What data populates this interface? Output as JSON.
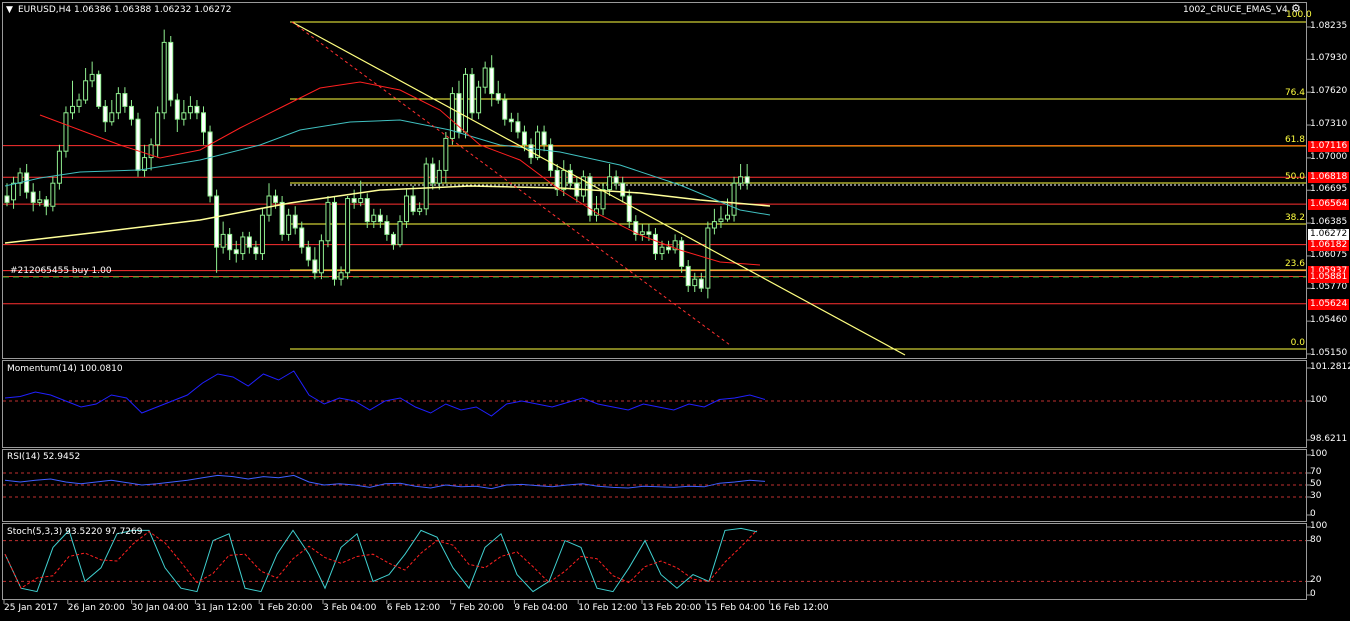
{
  "header": {
    "symbol_line": "EURUSD,H4  1.06386 1.06388 1.06232 1.06272",
    "indicator_name": "1002_CRUCE_EMAS_V4",
    "corner_value": "100.0"
  },
  "price_axis": [
    "1.08235",
    "1.07930",
    "1.07620",
    "1.07310",
    "1.07000",
    "1.06695",
    "1.06385",
    "1.06075",
    "1.05770",
    "1.05460",
    "1.05150"
  ],
  "price_tags": {
    "current": "1.06272",
    "red": [
      "1.07116",
      "1.06818",
      "1.06564",
      "1.06182",
      "1.05937",
      "1.05881",
      "1.05624"
    ]
  },
  "fib_levels": [
    "100.0",
    "76.4",
    "61.8",
    "50.0",
    "38.2",
    "23.6",
    "0.0"
  ],
  "order_label": "#212065455 buy 1.00",
  "panels": {
    "momentum": {
      "label": "Momentum(14) 100.0810",
      "axis": [
        "101.2812",
        "100",
        "98.6211"
      ]
    },
    "rsi": {
      "label": "RSI(14) 52.9452",
      "axis": [
        "100",
        "70",
        "50",
        "30",
        "0"
      ]
    },
    "stoch": {
      "label": "Stoch(5,3,3) 93.5220 97.7269",
      "axis": [
        "100",
        "80",
        "20",
        "0"
      ]
    }
  },
  "time_axis": [
    "25 Jan 2017",
    "26 Jan 20:00",
    "30 Jan 04:00",
    "31 Jan 12:00",
    "1 Feb 20:00",
    "3 Feb 04:00",
    "6 Feb 12:00",
    "7 Feb 20:00",
    "9 Feb 04:00",
    "10 Feb 12:00",
    "13 Feb 20:00",
    "15 Feb 04:00",
    "16 Feb 12:00"
  ],
  "colors": {
    "bull": "#90ee90",
    "bear": "#90ee90",
    "ema_slow": "#ffff99",
    "ema_mid": "#40c0c0",
    "ema_fast": "#ff2020",
    "level_red": "#ff3030",
    "trend": "#ffff80",
    "momentum": "#2020ff",
    "rsi": "#4060ff",
    "stoch_main": "#40d0d0",
    "stoch_signal": "#ff2020"
  }
}
